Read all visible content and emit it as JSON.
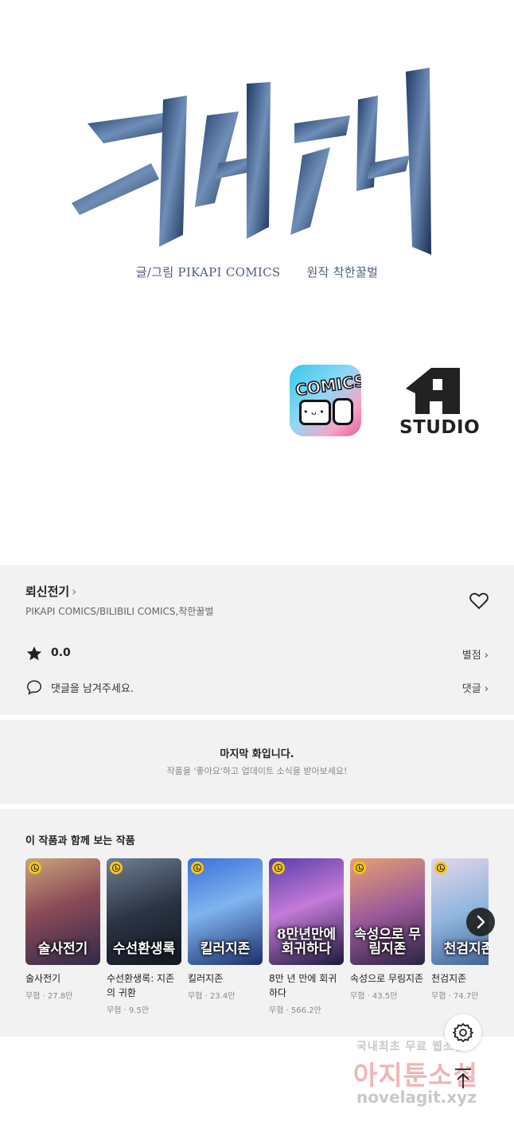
{
  "artwork": {
    "title_calligraphy": "뢰신전기",
    "credit_art": "글/그림 PIKAPI COMICS",
    "credit_original": "원작 착한꿀벌",
    "logo_comics_text": "COMICS",
    "logo_studio_text": "STUDIO"
  },
  "info": {
    "title": "뢰신전기",
    "chevron": "›",
    "authors": "PIKAPI COMICS/BILIBILI COMICS,착한꿀벌",
    "score": "0.0",
    "rate_link": "별점 ›",
    "comment_prompt": "댓글을 남겨주세요.",
    "comment_link": "댓글 ›"
  },
  "last_episode": {
    "title": "마지막 화입니다.",
    "subtitle": "작품을 '좋아요'하고 업데이트 소식을 받아보세요!"
  },
  "recommendations": {
    "heading": "이 작품과 함께 보는 작품",
    "items": [
      {
        "title": "술사전기",
        "meta": "무협 · 27.8만",
        "cover": "술사전기",
        "bg": "linear-gradient(160deg,#c9a57a 0%,#8b4a57 45%,#2f2a4a 100%)"
      },
      {
        "title": "수선환생록: 지존의 귀환",
        "meta": "무협 · 9.5만",
        "cover": "수선환생록",
        "bg": "linear-gradient(160deg,#6f7f93 0%,#2b3445 50%,#12161f 100%)"
      },
      {
        "title": "킬러지존",
        "meta": "무협 · 23.4만",
        "cover": "킬러지존",
        "bg": "linear-gradient(160deg,#3b6fd8 0%,#7fb4f0 45%,#1d2f6a 100%)"
      },
      {
        "title": "8만 년 만에 회귀하다",
        "meta": "무협 · 566.2만",
        "cover": "8만년만에 회귀하다",
        "bg": "linear-gradient(160deg,#5a3ea8 0%,#c47ad8 45%,#1c1a3a 100%)"
      },
      {
        "title": "속성으로 무림지존",
        "meta": "무협 · 43.5만",
        "cover": "속성으로 무림지존",
        "bg": "linear-gradient(160deg,#e8a070 0%,#9b5a9a 50%,#2b2340 100%)"
      },
      {
        "title": "천검지존",
        "meta": "무협 · 74.7만",
        "cover": "천검지존",
        "bg": "linear-gradient(160deg,#e3d6e9 0%,#8fb5de 50%,#3a5a8c 100%)"
      }
    ]
  },
  "watermark": {
    "line1": "국내최초 무료 웹소설",
    "line2": "아지툰소설",
    "line3": "novelagit.xyz"
  },
  "colors": {
    "panel_bg": "#f2f2f2",
    "credit_text": "#4e6079",
    "clock_badge": "#f6c51b"
  },
  "icons": [
    "heart-icon",
    "star-icon",
    "comment-icon",
    "chevron-right-icon",
    "gear-icon",
    "arrow-up-icon",
    "clock-badge-icon"
  ]
}
